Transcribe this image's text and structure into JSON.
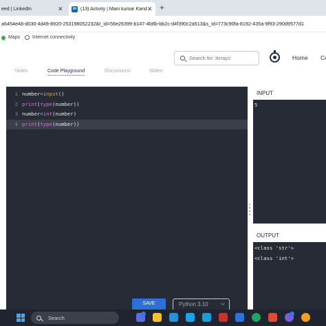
{
  "browser": {
    "tabs": [
      {
        "title": "eed | LinkedIn",
        "close": "✕"
      },
      {
        "title": "(13) Activity | Mani kumar Kand",
        "badge": "in",
        "close": "✕"
      }
    ],
    "new_tab": "+",
    "url": "a6454e48-d030-4d49-8920-253198052232&t_id=56e26399-b147-4b8b-bb2c-d4f390c2a513&s_id=773c90fa-8192-435a-9f93-290d9577d1",
    "bookmarks": [
      "Maps",
      "Internet connectivity"
    ]
  },
  "site": {
    "search_placeholder": "Search for 'Arrays'",
    "nav": [
      "Home",
      "Ce"
    ],
    "tabs": [
      {
        "label": "Notes",
        "active": false
      },
      {
        "label": "Code Playground",
        "active": true
      },
      {
        "label": "Discussions",
        "active": false
      },
      {
        "label": "Slides",
        "active": false
      }
    ]
  },
  "editor": {
    "lines": [
      {
        "n": "1",
        "tokens": [
          [
            "plain",
            "number"
          ],
          [
            "op",
            "="
          ],
          [
            "fn",
            "input"
          ],
          [
            "plain",
            "()"
          ]
        ]
      },
      {
        "n": "2",
        "tokens": [
          [
            "kw",
            "print"
          ],
          [
            "plain",
            "("
          ],
          [
            "kw",
            "type"
          ],
          [
            "plain",
            "(number))"
          ]
        ]
      },
      {
        "n": "3",
        "tokens": [
          [
            "plain",
            "number"
          ],
          [
            "op",
            "="
          ],
          [
            "kw",
            "int"
          ],
          [
            "plain",
            "(number)"
          ]
        ]
      },
      {
        "n": "4",
        "tokens": [
          [
            "kw",
            "print"
          ],
          [
            "plain",
            "("
          ],
          [
            "kw",
            "type"
          ],
          [
            "plain",
            "(number))"
          ]
        ],
        "current": true
      }
    ],
    "input_label": "INPUT",
    "input_value": "5",
    "output_label": "OUTPUT",
    "output_lines": [
      "<class 'str'>",
      "<class 'int'>"
    ],
    "save_label": "SAVE",
    "language": "Python 3.10"
  },
  "taskbar": {
    "search_label": "Search"
  },
  "colors": {
    "editor_bg": "#272b35",
    "accent_blue": "#2c6fd6",
    "tab_underline": "#e8a33c"
  }
}
